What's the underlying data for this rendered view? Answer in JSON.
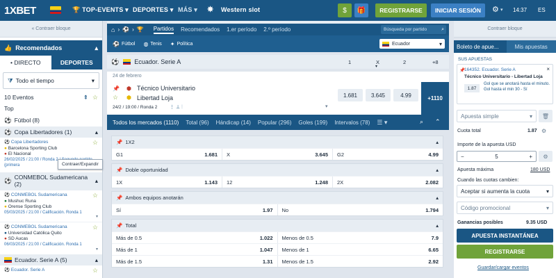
{
  "topbar": {
    "logo": "1XBET",
    "nav": [
      "TOP-EVENTS",
      "DEPORTES",
      "MÁS",
      "Western slot"
    ],
    "register": "REGISTRARSE",
    "login": "INICIAR SESIÓN",
    "time": "14:37",
    "lang": "ES"
  },
  "left": {
    "collapse": "« Contraer bloque",
    "recommended": "Recomendados",
    "tab_live": "• DIRECTO",
    "tab_sports": "DEPORTES",
    "period": "Todo el tiempo",
    "events_count": "10 Eventos",
    "top": "Top",
    "football": "Fútbol (8)",
    "groups": [
      {
        "title": "Copa Libertadores (1)",
        "matches": [
          {
            "league": "Copa Libertadores",
            "team1": "Barcelona Sporting Club",
            "team2": "El Nacional",
            "info": "26/02/2025 / 21:00 / Ronda 2 / Segundo partido (primera"
          }
        ]
      },
      {
        "title": "CONMEBOL Sudamericana (2)",
        "matches": [
          {
            "league": "CONMEBOL Sudamericana",
            "team1": "Mushuc Runa",
            "team2": "Orense Sporting Club",
            "info": "05/03/2025 / 21:00 / Calificación. Ronda 1"
          },
          {
            "league": "CONMEBOL Sudamericana",
            "team1": "Universidad Católica Quito",
            "team2": "SD Aucas",
            "info": "06/03/2025 / 21:00 / Calificación. Ronda 1"
          }
        ]
      },
      {
        "title": "Ecuador. Serie A (5)",
        "matches": [
          {
            "league": "Ecuador. Serie A",
            "team1": "",
            "team2": "",
            "info": ""
          }
        ]
      }
    ],
    "tooltip": "Contraer/Expandir"
  },
  "center": {
    "tabs": [
      "Partidos",
      "Recomendados",
      "1.er período",
      "2.º período"
    ],
    "search_placeholder": "Búsqueda por partido",
    "sports": [
      "Fútbol",
      "Tenis",
      "Política"
    ],
    "country": "Ecuador",
    "league": "Ecuador. Serie A",
    "cols": [
      "1",
      "X",
      "2",
      "+8"
    ],
    "date": "24 de febrero",
    "team1": "Técnico Universitario",
    "team2": "Libertad Loja",
    "match_info": "24/2 / 19:00 / Ronda 2",
    "odds": [
      "1.681",
      "3.645",
      "4.99"
    ],
    "more": "+1110",
    "market_tabs": [
      "Todos los mercados (1110)",
      "Total (96)",
      "Hándicap (14)",
      "Popular (296)",
      "Goles (199)",
      "Intervalos (78)"
    ],
    "markets": [
      {
        "title": "1X2",
        "rows": [
          [
            [
              "G1",
              "1.681"
            ],
            [
              "X",
              "3.645"
            ],
            [
              "G2",
              "4.99"
            ]
          ]
        ]
      },
      {
        "title": "Doble oportunidad",
        "rows": [
          [
            [
              "1X",
              "1.143"
            ],
            [
              "12",
              "1.248"
            ],
            [
              "2X",
              "2.082"
            ]
          ]
        ]
      },
      {
        "title": "Ambos equipos anotarán",
        "rows": [
          [
            [
              "Sí",
              "1.97"
            ],
            [
              "No",
              "1.794"
            ]
          ]
        ]
      },
      {
        "title": "Total",
        "rows": [
          [
            [
              "Más de 0.5",
              "1.022"
            ],
            [
              "Menos de 0.5",
              "7.9"
            ]
          ],
          [
            [
              "Más de 1",
              "1.047"
            ],
            [
              "Menos de 1",
              "6.65"
            ]
          ],
          [
            [
              "Más de 1.5",
              "1.31"
            ],
            [
              "Menos de 1.5",
              "2.92"
            ]
          ]
        ]
      }
    ]
  },
  "right": {
    "collapse": "Contraer bloque",
    "tab_slip": "Boleto de apue...",
    "tab_mybets": "Mis apuestas",
    "my_bets": "SUS APUESTAS",
    "bet_event": "164352. Ecuador. Serie A",
    "bet_match": "Técnico Universitario - Libertad Loja",
    "bet_odd": "1.87",
    "bet_desc": "Gol que se anotará hasta el minuto. Gol hasta el min 30 - Sí",
    "bet_type": "Apuesta simple",
    "total_odds_label": "Cuota total",
    "total_odds": "1.87",
    "amount_label": "Importe de la apuesta USD",
    "amount": "5",
    "max_label": "Apuesta máxima",
    "max_value": "180 USD",
    "when_change": "Cuando las cuotas cambien:",
    "accept": "Aceptar si aumenta la cuota",
    "promo": "Código promocional",
    "profit_label": "Ganancias posibles",
    "profit": "9.35 USD",
    "instant": "APUESTA INSTANTÁNEA",
    "register": "REGISTRARSE",
    "save": "Guardar/cargar eventos"
  }
}
